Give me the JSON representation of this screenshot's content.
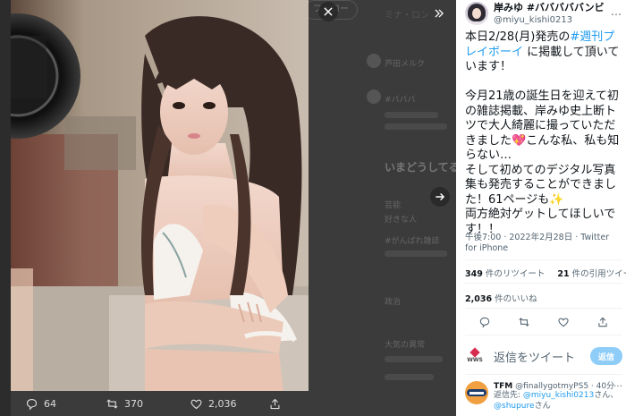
{
  "background_page": {
    "follow_label": "フォロー",
    "top_label": "ミナ・ロン",
    "rows": [
      "芦田メルク",
      "#バババ",
      "",
      "",
      ""
    ],
    "trend_heading": "いまどうしてる",
    "trend_rows": [
      "#がんばれ雑誌",
      "好きな人",
      "政治",
      "芸能",
      "大気の異常"
    ]
  },
  "photo": {
    "alt": "photo"
  },
  "photo_actions": {
    "reply_count": "64",
    "retweet_count": "370",
    "like_count": "2,036"
  },
  "author": {
    "display_name": "岸みゆ #バババババンビ",
    "handle": "@miyu_kishi0213",
    "more_label": "…"
  },
  "tweet": {
    "line1_prefix": "本日2/28(月)発売の",
    "hashtag": "#週刊プレイボーイ",
    "line1_suffix": " に掲載して頂いています！",
    "para2_a": "今月21歳の誕生日を迎えて初の雑誌掲載、岸みゆ史上断トツで大人綺麗に撮っていただきました",
    "heart": "💖",
    "para2_b": "こんな私、私も知らない…",
    "para3_a": "そして初めてのデジタル写真集も発売することができました！61ページも",
    "sparkle": "✨",
    "para3_b": "両方絶対ゲットしてほしいです！！"
  },
  "meta": {
    "timestamp": "午後7:00 · 2022年2月28日 · Twitter for iPhone"
  },
  "stats": {
    "retweets_value": "349",
    "retweets_label": "件のリツイート",
    "quotes_value": "21",
    "quotes_label": "件の引用ツイート",
    "likes_value": "2,036",
    "likes_label": "件のいいね"
  },
  "reply_box": {
    "logo_text": "WWS",
    "placeholder": "返信をツイート",
    "button_label": "返信"
  },
  "reply_tweet": {
    "name": "TFM",
    "handle": "@finallygotmyPS5 · 40分",
    "more": "…",
    "reply_prefix": "返信先: ",
    "reply_to_1": "@miyu_kishi0213",
    "reply_joiner": "さん、",
    "reply_to_2": "@shupure",
    "reply_suffix": "さん"
  },
  "colors": {
    "accent": "#1d9bf0",
    "heart": "#e0245e",
    "reply_button": "#8ecdf8"
  }
}
